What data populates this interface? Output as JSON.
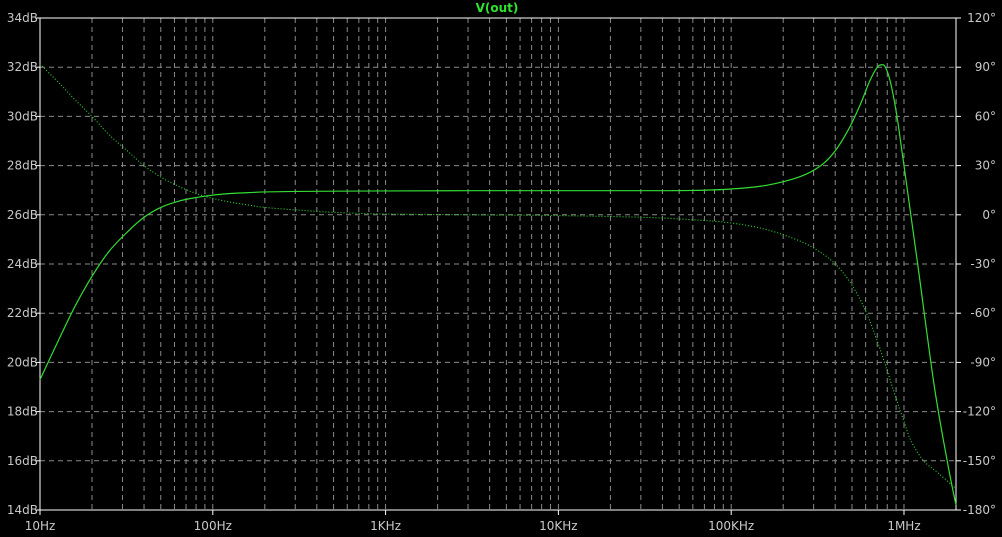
{
  "chart_data": {
    "type": "line",
    "title": "V(out)",
    "x_scale": "log",
    "xlim": [
      10,
      2000000
    ],
    "ylim_left": [
      14,
      34
    ],
    "ylim_right": [
      -180,
      120
    ],
    "grid": true,
    "x_ticks": [
      {
        "value": 10,
        "label": "10Hz"
      },
      {
        "value": 100,
        "label": "100Hz"
      },
      {
        "value": 1000,
        "label": "1KHz"
      },
      {
        "value": 10000,
        "label": "10KHz"
      },
      {
        "value": 100000,
        "label": "100KHz"
      },
      {
        "value": 1000000,
        "label": "1MHz"
      }
    ],
    "y_left_ticks": [
      {
        "value": 14,
        "label": "14dB"
      },
      {
        "value": 16,
        "label": "16dB"
      },
      {
        "value": 18,
        "label": "18dB"
      },
      {
        "value": 20,
        "label": "20dB"
      },
      {
        "value": 22,
        "label": "22dB"
      },
      {
        "value": 24,
        "label": "24dB"
      },
      {
        "value": 26,
        "label": "26dB"
      },
      {
        "value": 28,
        "label": "28dB"
      },
      {
        "value": 30,
        "label": "30dB"
      },
      {
        "value": 32,
        "label": "32dB"
      },
      {
        "value": 34,
        "label": "34dB"
      }
    ],
    "y_right_ticks": [
      {
        "value": -180,
        "label": "-180°"
      },
      {
        "value": -150,
        "label": "-150°"
      },
      {
        "value": -120,
        "label": "-120°"
      },
      {
        "value": -90,
        "label": "-90°"
      },
      {
        "value": -60,
        "label": "-60°"
      },
      {
        "value": -30,
        "label": "-30°"
      },
      {
        "value": 0,
        "label": "0°"
      },
      {
        "value": 30,
        "label": "30°"
      },
      {
        "value": 60,
        "label": "60°"
      },
      {
        "value": 90,
        "label": "90°"
      },
      {
        "value": 120,
        "label": "120°"
      }
    ],
    "series": [
      {
        "axis": "left",
        "style": "solid",
        "color": "#33dd33",
        "x": [
          10,
          13,
          16,
          20,
          25,
          32,
          40,
          50,
          63,
          80,
          100,
          130,
          160,
          200,
          300,
          500,
          1000,
          3000,
          10000,
          30000,
          60000,
          100000,
          160000,
          250000,
          330000,
          400000,
          480000,
          560000,
          630000,
          700000,
          750000,
          780000,
          820000,
          870000,
          920000,
          1000000,
          1200000,
          1500000,
          1800000,
          2000000
        ],
        "values": [
          19.3,
          21.0,
          22.3,
          23.5,
          24.5,
          25.3,
          25.9,
          26.3,
          26.55,
          26.7,
          26.8,
          26.87,
          26.9,
          26.93,
          26.95,
          26.96,
          26.97,
          26.98,
          26.98,
          26.98,
          26.99,
          27.05,
          27.2,
          27.55,
          28.0,
          28.6,
          29.5,
          30.5,
          31.4,
          32.0,
          32.1,
          32.0,
          31.6,
          30.8,
          29.8,
          28.0,
          24.0,
          19.0,
          15.8,
          14.2
        ]
      },
      {
        "axis": "right",
        "style": "dotted",
        "color": "#33dd33",
        "x": [
          10,
          13,
          16,
          20,
          25,
          32,
          40,
          50,
          63,
          80,
          100,
          130,
          160,
          200,
          300,
          500,
          1000,
          3000,
          10000,
          30000,
          60000,
          100000,
          160000,
          250000,
          330000,
          400000,
          480000,
          560000,
          630000,
          700000,
          750000,
          800000,
          900000,
          1000000,
          1100000,
          1300000,
          1600000,
          2000000
        ],
        "values": [
          92,
          80,
          70,
          60,
          49,
          39,
          30,
          23,
          17.5,
          13,
          10,
          7.5,
          6,
          4.5,
          3,
          1.5,
          0.5,
          0,
          -0.5,
          -1.5,
          -3,
          -5,
          -9,
          -16,
          -23,
          -30,
          -40,
          -52,
          -64,
          -77,
          -86,
          -95,
          -112,
          -126,
          -138,
          -150,
          -158,
          -167
        ]
      }
    ]
  }
}
